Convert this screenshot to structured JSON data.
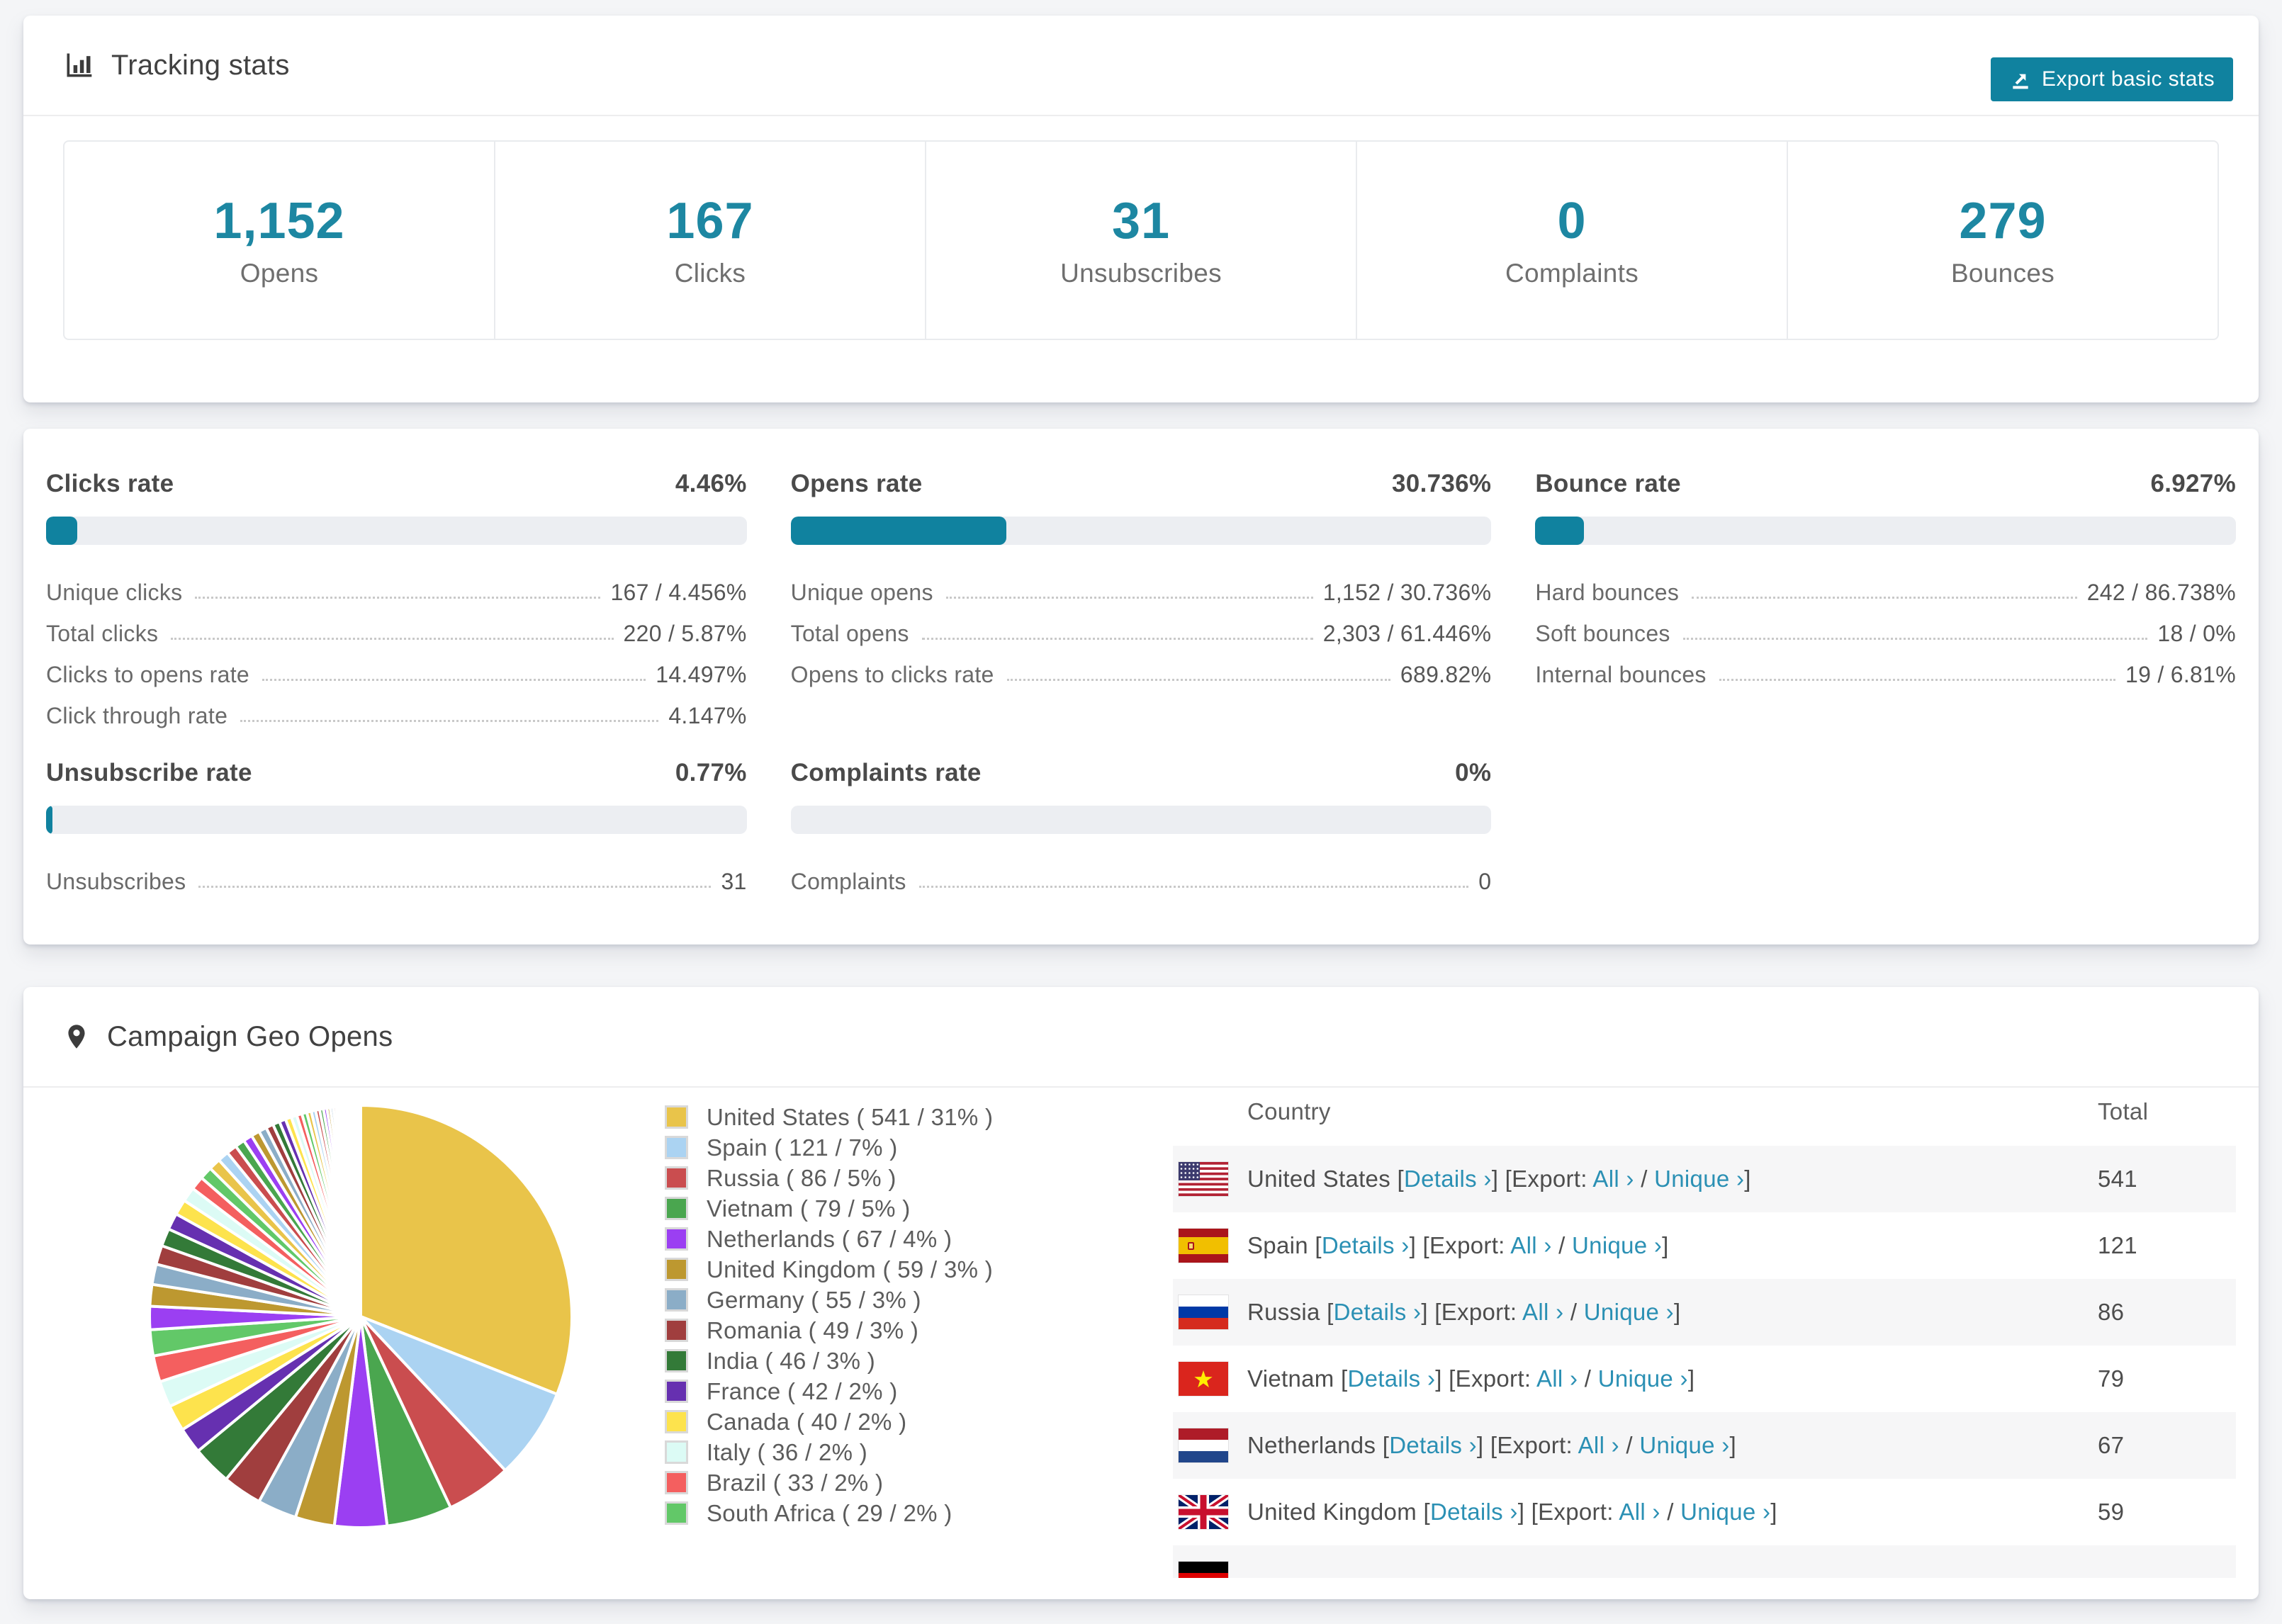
{
  "colors": {
    "accent": "#10829f",
    "number": "#1d87a2",
    "link": "#2b90b4",
    "page_bg": "#f4f5f7",
    "track": "#eceef2"
  },
  "tracking_card": {
    "title": "Tracking stats",
    "export_button": "Export basic stats",
    "stats": [
      {
        "value": "1,152",
        "label": "Opens"
      },
      {
        "value": "167",
        "label": "Clicks"
      },
      {
        "value": "31",
        "label": "Unsubscribes"
      },
      {
        "value": "0",
        "label": "Complaints"
      },
      {
        "value": "279",
        "label": "Bounces"
      }
    ]
  },
  "rates_card": {
    "sections": [
      {
        "title": "Clicks rate",
        "value": "4.46%",
        "pct": 4.46,
        "rows": [
          {
            "label": "Unique clicks",
            "value": "167 / 4.456%"
          },
          {
            "label": "Total clicks",
            "value": "220 / 5.87%"
          },
          {
            "label": "Clicks to opens rate",
            "value": "14.497%"
          },
          {
            "label": "Click through rate",
            "value": "4.147%"
          }
        ]
      },
      {
        "title": "Opens rate",
        "value": "30.736%",
        "pct": 30.736,
        "rows": [
          {
            "label": "Unique opens",
            "value": "1,152 / 30.736%"
          },
          {
            "label": "Total opens",
            "value": "2,303 / 61.446%"
          },
          {
            "label": "Opens to clicks rate",
            "value": "689.82%"
          }
        ]
      },
      {
        "title": "Bounce rate",
        "value": "6.927%",
        "pct": 6.927,
        "rows": [
          {
            "label": "Hard bounces",
            "value": "242 / 86.738%"
          },
          {
            "label": "Soft bounces",
            "value": "18 / 0%"
          },
          {
            "label": "Internal bounces",
            "value": "19 / 6.81%"
          }
        ]
      },
      {
        "title": "Unsubscribe rate",
        "value": "0.77%",
        "pct": 0.77,
        "rows": [
          {
            "label": "Unsubscribes",
            "value": "31"
          }
        ]
      },
      {
        "title": "Complaints rate",
        "value": "0%",
        "pct": 0,
        "rows": [
          {
            "label": "Complaints",
            "value": "0"
          }
        ]
      }
    ]
  },
  "geo_card": {
    "title": "Campaign Geo Opens",
    "table": {
      "headers": {
        "country": "Country",
        "total": "Total"
      },
      "link_labels": {
        "open_bracket": "[",
        "close_bracket": "]",
        "details": "Details ›",
        "export_prefix": "Export:",
        "all": "All ›",
        "slash": "/",
        "unique": "Unique ›"
      },
      "rows": [
        {
          "country": "United States",
          "flag": "us",
          "total": "541"
        },
        {
          "country": "Spain",
          "flag": "es",
          "total": "121"
        },
        {
          "country": "Russia",
          "flag": "ru",
          "total": "86"
        },
        {
          "country": "Vietnam",
          "flag": "vn",
          "total": "79"
        },
        {
          "country": "Netherlands",
          "flag": "nl",
          "total": "67"
        },
        {
          "country": "United Kingdom",
          "flag": "gb",
          "total": "59"
        },
        {
          "country": "",
          "flag": "de",
          "total": ""
        }
      ]
    }
  },
  "chart_data": {
    "type": "pie",
    "title": "Campaign Geo Opens",
    "legend_position": "right",
    "start_angle_deg": -90,
    "direction": "clockwise",
    "series": [
      {
        "label": "United States",
        "value": 541,
        "pct": 31,
        "color": "#e9c44a",
        "legend_label": "United States ( 541 / 31% )"
      },
      {
        "label": "Spain",
        "value": 121,
        "pct": 7,
        "color": "#abd3f2",
        "legend_label": "Spain ( 121 / 7% )"
      },
      {
        "label": "Russia",
        "value": 86,
        "pct": 5,
        "color": "#ca4d4f",
        "legend_label": "Russia ( 86 / 5% )"
      },
      {
        "label": "Vietnam",
        "value": 79,
        "pct": 5,
        "color": "#4aa64f",
        "legend_label": "Vietnam ( 79 / 5% )"
      },
      {
        "label": "Netherlands",
        "value": 67,
        "pct": 4,
        "color": "#9b3ff2",
        "legend_label": "Netherlands ( 67 / 4% )"
      },
      {
        "label": "United Kingdom",
        "value": 59,
        "pct": 3,
        "color": "#bd9830",
        "legend_label": "United Kingdom ( 59 / 3% )"
      },
      {
        "label": "Germany",
        "value": 55,
        "pct": 3,
        "color": "#8badc7",
        "legend_label": "Germany ( 55 / 3% )"
      },
      {
        "label": "Romania",
        "value": 49,
        "pct": 3,
        "color": "#a03e3e",
        "legend_label": "Romania ( 49 / 3% )"
      },
      {
        "label": "India",
        "value": 46,
        "pct": 3,
        "color": "#337a38",
        "legend_label": "India ( 46 / 3% )"
      },
      {
        "label": "France",
        "value": 42,
        "pct": 2,
        "color": "#6630b0",
        "legend_label": "France ( 42 / 2% )"
      },
      {
        "label": "Canada",
        "value": 40,
        "pct": 2,
        "color": "#fde34d",
        "legend_label": "Canada ( 40 / 2% )"
      },
      {
        "label": "Italy",
        "value": 36,
        "pct": 2,
        "color": "#dcfbf5",
        "legend_label": "Italy ( 36 / 2% )"
      },
      {
        "label": "Brazil",
        "value": 33,
        "pct": 2,
        "color": "#f45f5f",
        "legend_label": "Brazil ( 33 / 2% )"
      },
      {
        "label": "South Africa",
        "value": 29,
        "pct": 2,
        "color": "#62c868",
        "legend_label": "South Africa ( 29 / 2% )"
      }
    ],
    "others": {
      "total_pct_approx": 26,
      "est_slice_count": 45
    }
  }
}
